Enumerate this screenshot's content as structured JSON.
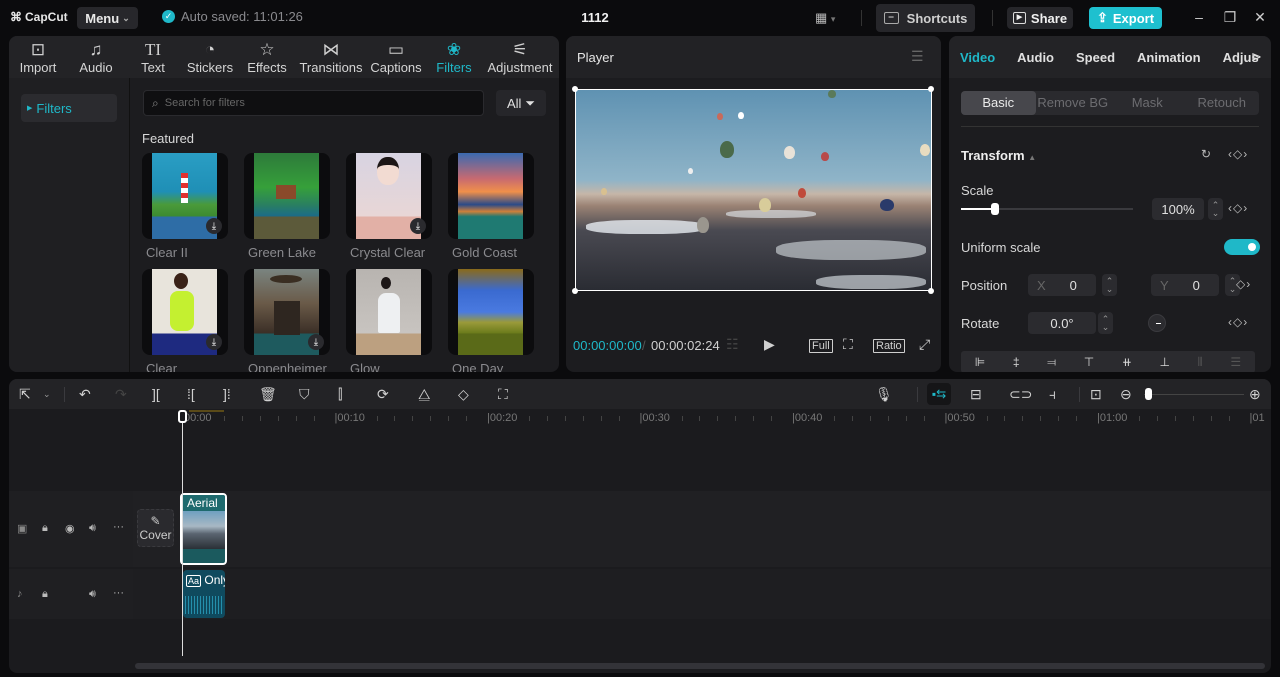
{
  "titlebar": {
    "logo": "CapCut",
    "menu_label": "Menu",
    "autosave": "Auto saved: 11:01:26",
    "project_title": "1112",
    "shortcuts_label": "Shortcuts",
    "share_label": "Share",
    "export_label": "Export",
    "accent_color": "#1ec0cf"
  },
  "media_toolbar": {
    "items": [
      {
        "label": "Import",
        "icon": "import-icon"
      },
      {
        "label": "Audio",
        "icon": "audio-icon"
      },
      {
        "label": "Text",
        "icon": "text-icon"
      },
      {
        "label": "Stickers",
        "icon": "stickers-icon"
      },
      {
        "label": "Effects",
        "icon": "effects-icon"
      },
      {
        "label": "Transitions",
        "icon": "transitions-icon"
      },
      {
        "label": "Captions",
        "icon": "captions-icon"
      },
      {
        "label": "Filters",
        "icon": "filters-icon",
        "active": true
      },
      {
        "label": "Adjustment",
        "icon": "adjustment-icon"
      }
    ]
  },
  "filters_panel": {
    "sidebar_item": "Filters",
    "search_placeholder": "Search for filters",
    "filter_dropdown": "All",
    "section_title": "Featured",
    "cards": [
      {
        "label": "Clear II",
        "download": true
      },
      {
        "label": "Green Lake",
        "download": false
      },
      {
        "label": "Crystal Clear",
        "download": true
      },
      {
        "label": "Gold Coast",
        "download": false
      },
      {
        "label": "Clear",
        "download": true
      },
      {
        "label": "Oppenheimer",
        "download": true
      },
      {
        "label": "Glow",
        "download": false
      },
      {
        "label": "One Day",
        "download": false
      }
    ]
  },
  "player": {
    "title": "Player",
    "current_time": "00:00:00:00",
    "separator": "/",
    "total_time": "00:00:02:24",
    "full_label": "Full",
    "ratio_label": "Ratio"
  },
  "inspector": {
    "tabs": [
      "Video",
      "Audio",
      "Speed",
      "Animation",
      "Adjus"
    ],
    "active_tab": "Video",
    "subtabs": [
      "Basic",
      "Remove BG",
      "Mask",
      "Retouch"
    ],
    "active_subtab": "Basic",
    "section_title": "Transform",
    "scale_label": "Scale",
    "scale_value": "100%",
    "scale_slider_fraction": 0.2,
    "uniform_scale_label": "Uniform scale",
    "uniform_scale_on": true,
    "position_label": "Position",
    "position_x_label": "X",
    "position_x": "0",
    "position_y_label": "Y",
    "position_y": "0",
    "rotate_label": "Rotate",
    "rotate_value": "0.0°"
  },
  "timeline": {
    "ruler": [
      "00:00",
      "00:10",
      "00:20",
      "00:30",
      "00:40",
      "00:50",
      "01:00",
      "01"
    ],
    "cover_label": "Cover",
    "video_clip_label": "Aerial",
    "audio_clip_label": "Only"
  }
}
